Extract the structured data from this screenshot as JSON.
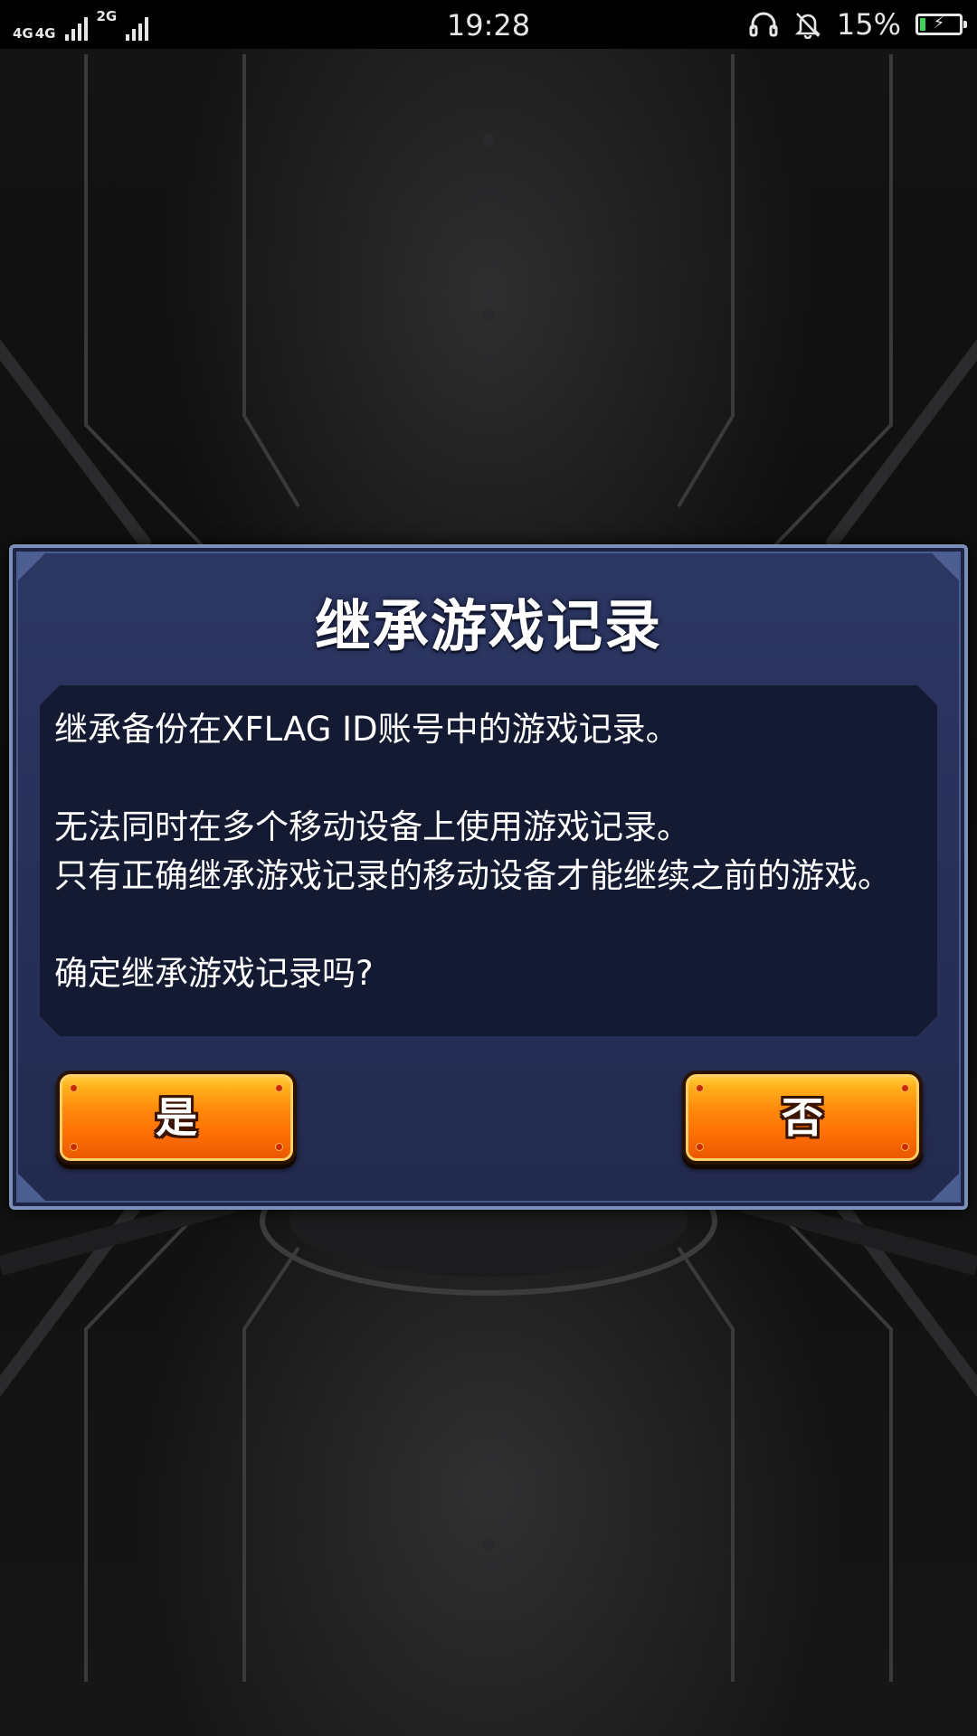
{
  "status_bar": {
    "network_1": "4G",
    "network_1b": "4G",
    "network_2": "2G",
    "time": "19:28",
    "battery_percent_text": "15%",
    "battery_level": 0.15,
    "icons": [
      "headset-icon",
      "mute-bell-icon",
      "battery-charging-icon"
    ]
  },
  "dialog": {
    "title": "继承游戏记录",
    "lines": [
      "继承备份在XFLAG ID账号中的游戏记录。",
      "无法同时在多个移动设备上使用游戏记录。",
      "只有正确继承游戏记录的移动设备才能继续之前的游戏。",
      "确定继承游戏记录吗?"
    ],
    "yes_label": "是",
    "no_label": "否"
  },
  "colors": {
    "dialog_bg": "#2a3560",
    "body_bg": "#141a31",
    "button_orange": "#ff7a08",
    "battery_green": "#3fd35c"
  }
}
